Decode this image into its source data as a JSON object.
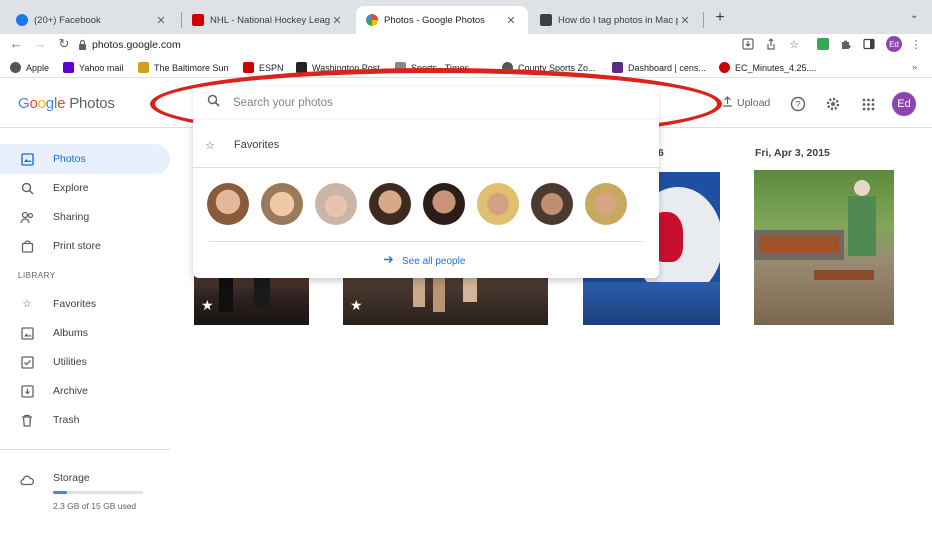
{
  "browser": {
    "tabs": [
      {
        "title": "(20+) Facebook",
        "active": false
      },
      {
        "title": "NHL - National Hockey League",
        "active": false
      },
      {
        "title": "Photos - Google Photos",
        "active": true
      },
      {
        "title": "How do I tag photos in Mac ph",
        "active": false
      }
    ],
    "new_tab": "+",
    "url": "photos.google.com",
    "profile_initials": "Ed",
    "bookmarks": [
      {
        "label": "Apple",
        "icon": "apple-icon",
        "color": "#555555"
      },
      {
        "label": "Yahoo mail",
        "icon": "yahoo-icon",
        "color": "#6001d2"
      },
      {
        "label": "The Baltimore Sun",
        "icon": "baltimore-sun-icon",
        "color": "#d4a017"
      },
      {
        "label": "ESPN",
        "icon": "espn-icon",
        "color": "#d00000"
      },
      {
        "label": "Washington Post",
        "icon": "washington-post-icon",
        "color": "#222222"
      },
      {
        "label": "Sports - Times",
        "icon": "document-icon",
        "color": "#888888"
      },
      {
        "label": "County Sports Zo...",
        "icon": "county-sports-icon",
        "color": "#555555"
      },
      {
        "label": "Dashboard | cens...",
        "icon": "dashboard-icon",
        "color": "#5a2d82"
      },
      {
        "label": "EC_Minutes_4.25....",
        "icon": "ec-minutes-icon",
        "color": "#cc0000"
      }
    ]
  },
  "app": {
    "logo_google": "Google",
    "logo_product": "Photos",
    "search_placeholder": "Search your photos",
    "upload_label": "Upload",
    "avatar_initials": "Ed"
  },
  "sidebar": {
    "items": [
      {
        "label": "Photos",
        "icon": "photos-icon",
        "active": true
      },
      {
        "label": "Explore",
        "icon": "search-icon",
        "active": false
      },
      {
        "label": "Sharing",
        "icon": "sharing-icon",
        "active": false
      },
      {
        "label": "Print store",
        "icon": "print-store-icon",
        "active": false
      }
    ],
    "library_heading": "LIBRARY",
    "library_items": [
      {
        "label": "Favorites",
        "icon": "star-icon"
      },
      {
        "label": "Albums",
        "icon": "albums-icon"
      },
      {
        "label": "Utilities",
        "icon": "utilities-icon"
      },
      {
        "label": "Archive",
        "icon": "archive-icon"
      },
      {
        "label": "Trash",
        "icon": "trash-icon"
      }
    ],
    "storage": {
      "label": "Storage",
      "used_text": "2.3 GB of 15 GB used",
      "used_fraction": 0.153
    }
  },
  "dropdown": {
    "favorites_label": "Favorites",
    "people_count": 8,
    "see_all_label": "See all people"
  },
  "photos": {
    "dates": [
      "6",
      "Fri, Apr 3, 2015"
    ]
  },
  "colors": {
    "accent": "#1a73e8",
    "annotation_red": "#d9231c",
    "active_nav_bg": "#e8f0fe",
    "avatar_purple": "#8e44ad"
  }
}
